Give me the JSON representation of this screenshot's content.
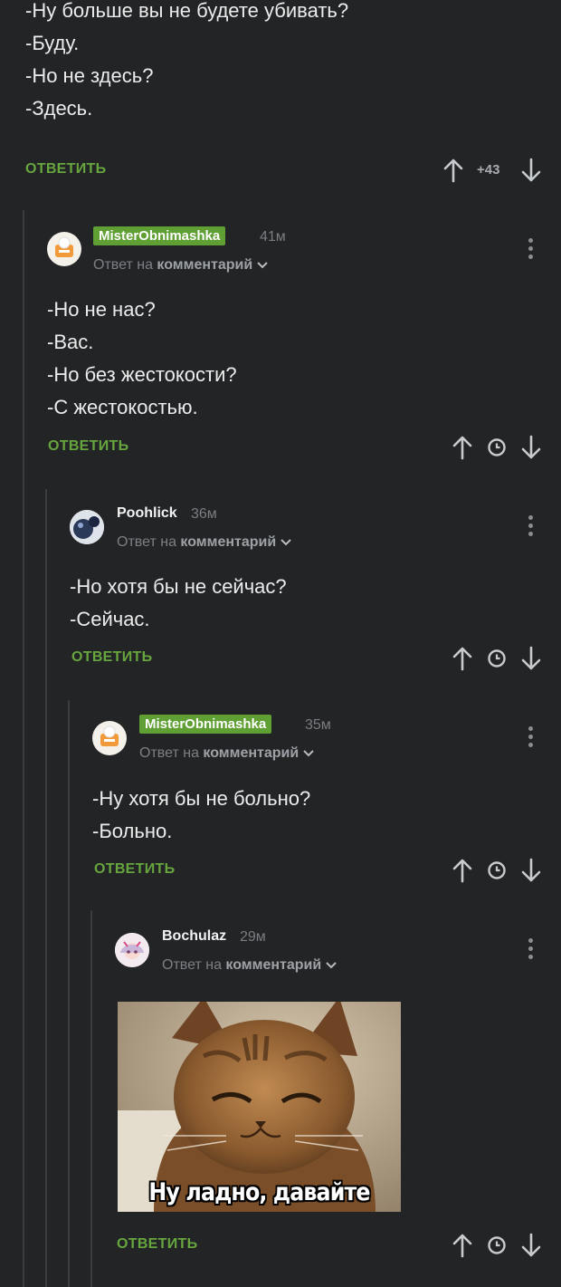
{
  "top_comment": {
    "text": "-Ну больше вы не будете убивать?\n-Буду.\n-Но не здесь?\n-Здесь.",
    "reply_label": "ОТВЕТИТЬ",
    "score": "+43"
  },
  "comments": [
    {
      "author": "MisterObnimashka",
      "time": "41м",
      "reply_prefix": "Ответ на",
      "reply_target": "комментарий",
      "text": "-Но не нас?\n-Вас.\n-Но без жестокости?\n-С жестокостью.",
      "reply_label": "ОТВЕТИТЬ"
    },
    {
      "author": "Poohlick",
      "time": "36м",
      "reply_prefix": "Ответ на",
      "reply_target": "комментарий",
      "text": "-Но хотя бы не сейчас?\n-Сейчас.",
      "reply_label": "ОТВЕТИТЬ"
    },
    {
      "author": "MisterObnimashka",
      "time": "35м",
      "reply_prefix": "Ответ на",
      "reply_target": "комментарий",
      "text": "-Ну хотя бы не больно?\n-Больно.",
      "reply_label": "ОТВЕТИТЬ"
    },
    {
      "author": "Bochulaz",
      "time": "29м",
      "reply_prefix": "Ответ на",
      "reply_target": "комментарий",
      "meme_caption": "Ну ладно, давайте",
      "reply_label": "ОТВЕТИТЬ"
    }
  ],
  "colors": {
    "background": "#222426",
    "accent_green": "#67a53e",
    "badge_green": "#5f9f34",
    "muted": "#7c8084"
  },
  "icons": [
    "arrow-up-icon",
    "arrow-down-icon",
    "clock-icon",
    "more-vertical-icon",
    "chevron-down-icon"
  ]
}
